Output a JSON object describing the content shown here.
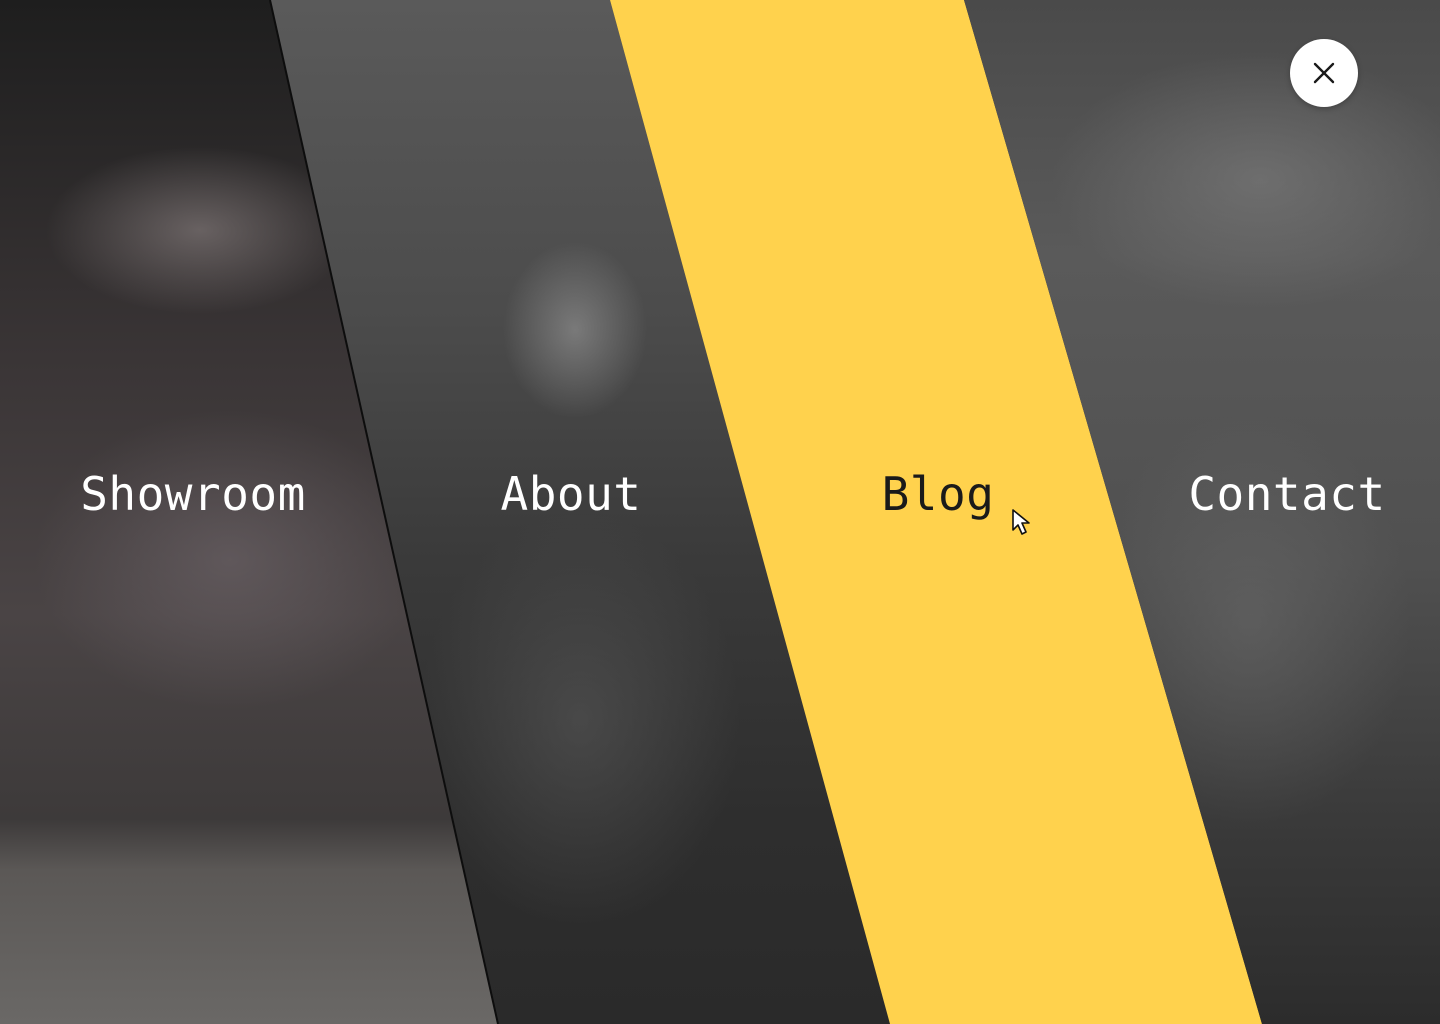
{
  "menu": {
    "items": [
      {
        "label": "Showroom",
        "active": false
      },
      {
        "label": "About",
        "active": false
      },
      {
        "label": "Blog",
        "active": true
      },
      {
        "label": "Contact",
        "active": false
      }
    ]
  },
  "colors": {
    "accent": "#ffd24d",
    "active_text": "#1a1a1a",
    "inactive_text": "#ffffff",
    "close_button_bg": "#ffffff"
  },
  "icons": {
    "close": "close-icon",
    "cursor": "mouse-pointer-icon"
  }
}
